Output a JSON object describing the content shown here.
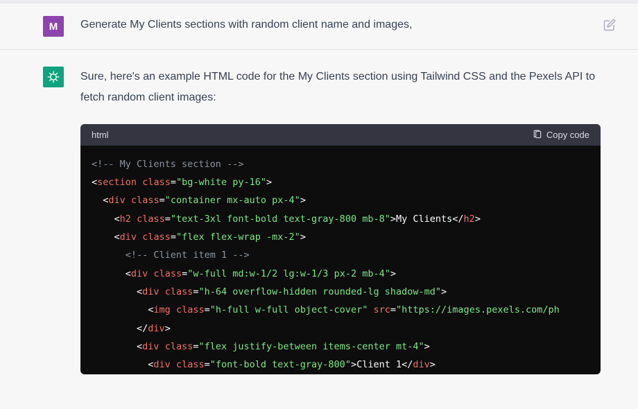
{
  "user": {
    "avatar_letter": "M",
    "prompt": "Generate My Clients sections with random client name and images,"
  },
  "assistant": {
    "intro": "Sure, here's an example HTML code for the My Clients section using Tailwind CSS and the Pexels API to fetch random client images:"
  },
  "code": {
    "lang_label": "html",
    "copy_label": "Copy code",
    "lines": {
      "c1": "<!-- My Clients section -->",
      "attr_class": "class",
      "l2_val": "bg-white py-16",
      "l3_val": "container mx-auto px-4",
      "l4_val": "text-3xl font-bold text-gray-800 mb-8",
      "l4_text": "My Clients",
      "l5_val": "flex flex-wrap -mx-2",
      "c2": "<!-- Client item 1 -->",
      "l7_val": "w-full md:w-1/2 lg:w-1/3 px-2 mb-4",
      "l8_val": "h-64 overflow-hidden rounded-lg shadow-md",
      "l9_val": "h-full w-full object-cover",
      "l9_src_attr": "src",
      "l9_src_val": "https://images.pexels.com/ph",
      "l11_val": "flex justify-between items-center mt-4",
      "l12_val": "font-bold text-gray-800",
      "l12_text": "Client 1",
      "tag_section": "section",
      "tag_div": "div",
      "tag_h2": "h2",
      "tag_img": "img"
    }
  }
}
